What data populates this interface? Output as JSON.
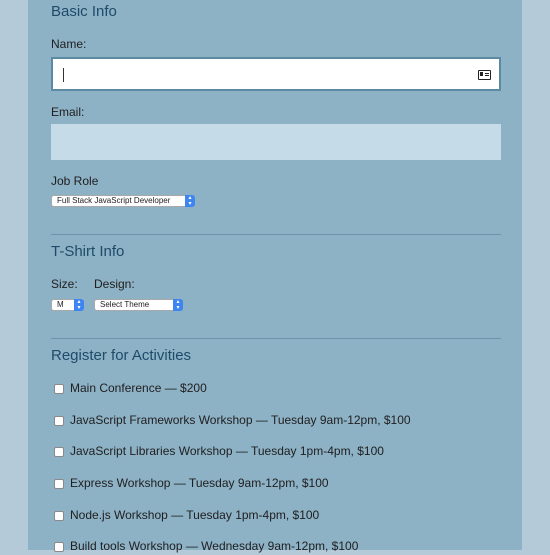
{
  "basic_info": {
    "heading": "Basic Info",
    "name_label": "Name:",
    "name_value": "",
    "email_label": "Email:",
    "email_value": "",
    "job_role_label": "Job Role",
    "job_role_selected": "Full Stack JavaScript Developer"
  },
  "tshirt": {
    "heading": "T-Shirt Info",
    "size_label": "Size:",
    "size_selected": "M",
    "design_label": "Design:",
    "design_selected": "Select Theme"
  },
  "activities": {
    "heading": "Register for Activities",
    "items": [
      {
        "label": "Main Conference — $200",
        "checked": false
      },
      {
        "label": "JavaScript Frameworks Workshop — Tuesday 9am-12pm, $100",
        "checked": false
      },
      {
        "label": "JavaScript Libraries Workshop — Tuesday 1pm-4pm, $100",
        "checked": false
      },
      {
        "label": "Express Workshop — Tuesday 9am-12pm, $100",
        "checked": false
      },
      {
        "label": "Node.js Workshop — Tuesday 1pm-4pm, $100",
        "checked": false
      },
      {
        "label": "Build tools Workshop — Wednesday 9am-12pm, $100",
        "checked": false
      }
    ]
  },
  "colors": {
    "page_bg": "#b4cad8",
    "panel_bg": "#8db1c5",
    "heading": "#1f4b69",
    "select_arrow": "#3d85f0"
  },
  "icons": {
    "name_field_icon": "contact-card-icon"
  }
}
